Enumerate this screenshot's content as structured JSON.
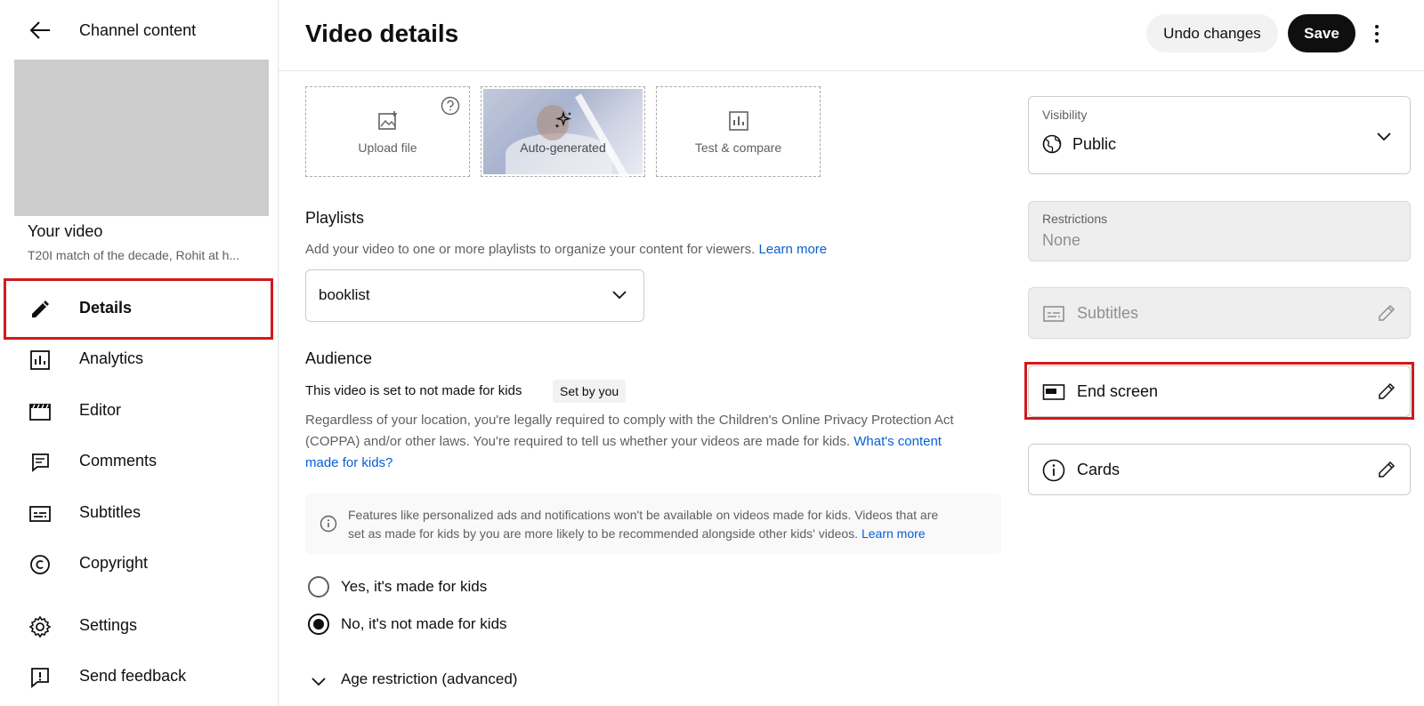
{
  "sidebar": {
    "header_title": "Channel content",
    "your_video_label": "Your video",
    "video_title": "T20I match of the decade, Rohit at h...",
    "nav": [
      {
        "label": "Details",
        "icon": "pencil-icon",
        "active": true
      },
      {
        "label": "Analytics",
        "icon": "analytics-icon"
      },
      {
        "label": "Editor",
        "icon": "editor-clapper-icon"
      },
      {
        "label": "Comments",
        "icon": "comments-icon"
      },
      {
        "label": "Subtitles",
        "icon": "subtitles-icon"
      },
      {
        "label": "Copyright",
        "icon": "copyright-icon"
      },
      {
        "label": "Settings",
        "icon": "gear-icon"
      },
      {
        "label": "Send feedback",
        "icon": "feedback-icon"
      }
    ]
  },
  "header": {
    "title": "Video details",
    "undo_label": "Undo changes",
    "save_label": "Save"
  },
  "thumbnail_options": [
    {
      "label": "Upload file",
      "icon": "upload-image-icon"
    },
    {
      "label": "Auto-generated",
      "icon": "sparkle-icon"
    },
    {
      "label": "Test & compare",
      "icon": "compare-chart-icon"
    }
  ],
  "playlists": {
    "title": "Playlists",
    "help": "Add your video to one or more playlists to organize your content for viewers.",
    "learn_more": "Learn more",
    "selected": "booklist"
  },
  "audience": {
    "title": "Audience",
    "status": "This video is set to not made for kids",
    "badge": "Set by you",
    "help_line1": "Regardless of your location, you're legally required to comply with the Children's Online Privacy Protection Act",
    "help_line2": "(COPPA) and/or other laws. You're required to tell us whether your videos are made for kids.",
    "link_line2": "What's content",
    "link_line3": "made for kids?",
    "info_line1": "Features like personalized ads and notifications won't be available on videos made for kids. Videos that are",
    "info_line2": "set as made for kids by you are more likely to be recommended alongside other kids' videos.",
    "info_link": "Learn more",
    "option_yes": "Yes, it's made for kids",
    "option_no": "No, it's not made for kids",
    "selected": "no",
    "age_restriction": "Age restriction (advanced)"
  },
  "right_panel": {
    "visibility_label": "Visibility",
    "visibility_value": "Public",
    "restrictions_label": "Restrictions",
    "restrictions_value": "None",
    "subtitles_label": "Subtitles",
    "end_screen_label": "End screen",
    "cards_label": "Cards"
  },
  "colors": {
    "highlight_box": "#d11a1a",
    "link": "#065fd4",
    "save_button": "#0f0f0f"
  }
}
